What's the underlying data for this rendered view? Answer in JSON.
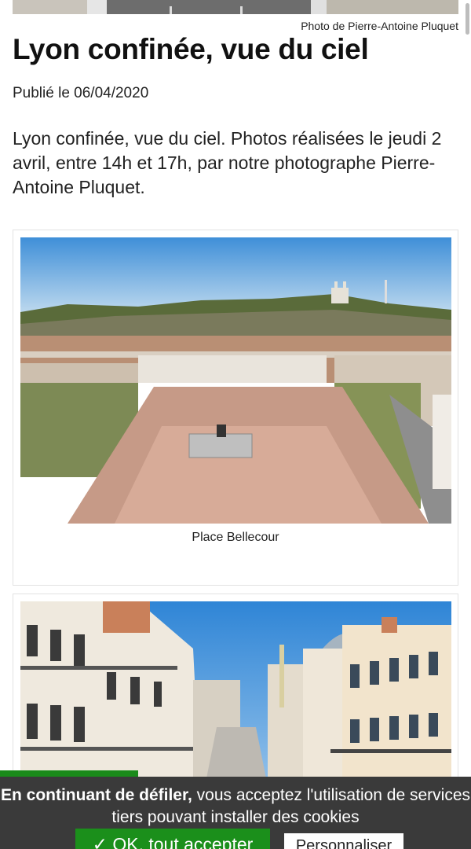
{
  "article": {
    "photo_credit": "Photo de Pierre-Antoine Pluquet",
    "title": "Lyon confinée, vue du ciel",
    "published": "Publié le 06/04/2020",
    "intro": "Lyon confinée, vue du ciel. Photos réalisées le jeudi 2 avril, entre 14h et 17h, par notre photographe Pierre-Antoine Pluquet."
  },
  "gallery": [
    {
      "caption": "Place Bellecour"
    },
    {
      "caption": ""
    }
  ],
  "cookie_banner": {
    "text_bold": "En continuant de défiler,",
    "text_rest": " vous acceptez l'utilisation de services tiers pouvant installer des cookies",
    "accept_label": "✓ OK, tout accepter",
    "customize_label": "Personnaliser"
  },
  "colors": {
    "cookie_bg": "#3a3a3a",
    "accept_green": "#1b8f1b"
  }
}
